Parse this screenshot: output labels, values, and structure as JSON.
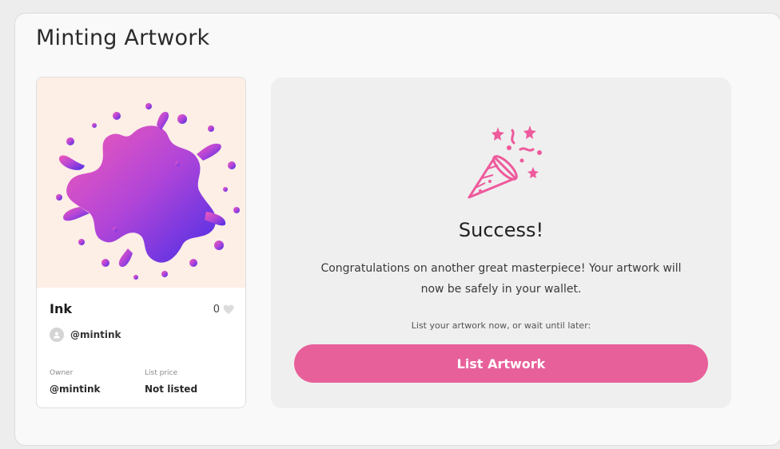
{
  "page": {
    "title": "Minting Artwork"
  },
  "card": {
    "name": "Ink",
    "likes": "0",
    "creator_handle": "@mintink",
    "owner_label": "Owner",
    "owner_value": "@mintink",
    "price_label": "List price",
    "price_value": "Not listed",
    "art_background": "#fdeee6"
  },
  "success": {
    "title": "Success!",
    "message": "Congratulations on another great masterpiece! Your artwork will now be safely in your wallet.",
    "hint": "List your artwork now, or wait until later:",
    "button_label": "List Artwork",
    "icon": "party-popper-icon",
    "accent_color": "#e8609a"
  }
}
